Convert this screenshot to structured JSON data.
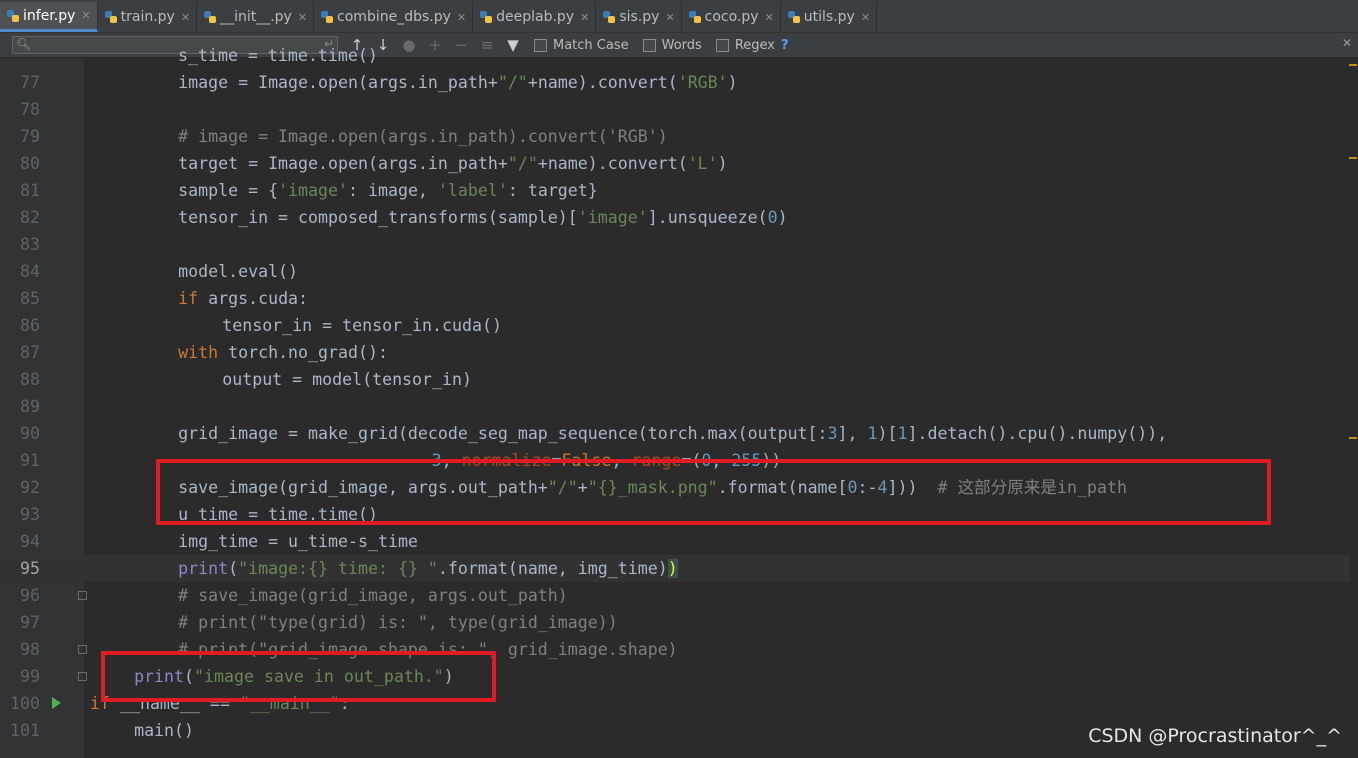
{
  "tabs": [
    {
      "label": "infer.py",
      "active": true
    },
    {
      "label": "train.py"
    },
    {
      "label": "__init__.py"
    },
    {
      "label": "combine_dbs.py"
    },
    {
      "label": "deeplab.py"
    },
    {
      "label": "sis.py"
    },
    {
      "label": "coco.py"
    },
    {
      "label": "utils.py"
    }
  ],
  "search": {
    "placeholder": "",
    "match_case": "Match Case",
    "words": "Words",
    "regex": "Regex",
    "help": "?"
  },
  "current_line": "95",
  "lines": [
    {
      "n": "77",
      "code": "        image = Image.open(args.in_path+\"/\"+name).convert('RGB')"
    },
    {
      "n": "78",
      "code": ""
    },
    {
      "n": "79",
      "code": "        # image = Image.open(args.in_path).convert('RGB')"
    },
    {
      "n": "80",
      "code": "        target = Image.open(args.in_path+\"/\"+name).convert('L')"
    },
    {
      "n": "81",
      "code": "        sample = {'image': image, 'label': target}"
    },
    {
      "n": "82",
      "code": "        tensor_in = composed_transforms(sample)['image'].unsqueeze(0)"
    },
    {
      "n": "83",
      "code": ""
    },
    {
      "n": "84",
      "code": "        model.eval()"
    },
    {
      "n": "85",
      "code": "        if args.cuda:"
    },
    {
      "n": "86",
      "code": "            tensor_in = tensor_in.cuda()"
    },
    {
      "n": "87",
      "code": "        with torch.no_grad():"
    },
    {
      "n": "88",
      "code": "            output = model(tensor_in)"
    },
    {
      "n": "89",
      "code": ""
    },
    {
      "n": "90",
      "code": "        grid_image = make_grid(decode_seg_map_sequence(torch.max(output[:3], 1)[1].detach().cpu().numpy()),"
    },
    {
      "n": "91",
      "code": "                               3, normalize=False, range=(0, 255))"
    },
    {
      "n": "92",
      "code": "        save_image(grid_image, args.out_path+\"/\"+\"{}_mask.png\".format(name[0:-4]))  # 这部分原来是in_path"
    },
    {
      "n": "93",
      "code": "        u_time = time.time()"
    },
    {
      "n": "94",
      "code": "        img_time = u_time-s_time"
    },
    {
      "n": "95",
      "code": "        print(\"image:{} time: {} \".format(name, img_time))"
    },
    {
      "n": "96",
      "code": "        # save_image(grid_image, args.out_path)"
    },
    {
      "n": "97",
      "code": "        # print(\"type(grid) is: \", type(grid_image))"
    },
    {
      "n": "98",
      "code": "        # print(\"grid_image.shape is: \", grid_image.shape)"
    },
    {
      "n": "99",
      "code": "    print(\"image save in out_path.\")"
    },
    {
      "n": "100",
      "code": "if __name__ == \"__main__\":"
    },
    {
      "n": "101",
      "code": "    main()"
    }
  ],
  "partial_top": "        s_time = time.time()",
  "watermark": "CSDN @Procrastinator^_^",
  "colors": {
    "accent": "#4a88c7",
    "highlight_box": "#e01b24"
  }
}
